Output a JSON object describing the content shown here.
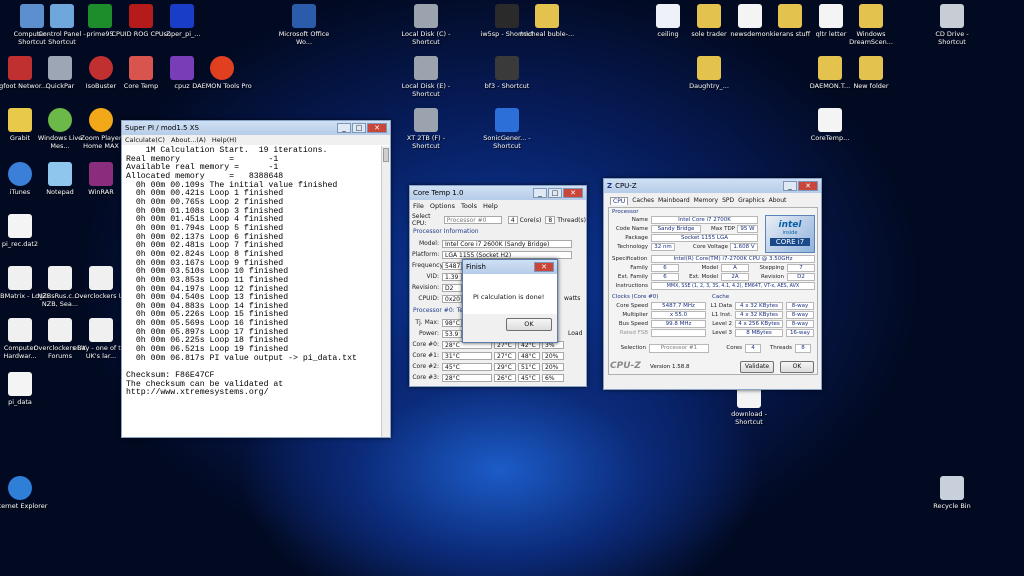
{
  "desktop_icons": {
    "computer": "Computer - Shortcut",
    "control_panel": "Control Panel - Shortcut",
    "prime95": "prime95",
    "cpuid_rog": "CPUID ROG CPU-Z",
    "super_pi": "super_pi_...",
    "ms_office": "Microsoft Office Wo...",
    "local_disk_c": "Local Disk (C) - Shortcut",
    "iw5sp": "iw5sp - Shortcut",
    "micheal_buble": "micheal buble-...",
    "ceiling": "ceiling",
    "sole_trader": "sole trader",
    "newsdemon": "newsdemon",
    "kierans_stuff": "kierans stuff",
    "qltr_letter": "qltr letter",
    "windows_dreamscene": "Windows DreamScen...",
    "cd_drive": "CD Drive - Shortcut",
    "bigfoot": "Bigfoot Networ...",
    "quickpar": "QuickPar",
    "isobuster": "IsoBuster",
    "core_temp": "Core Temp",
    "cpuz": "cpuz",
    "daemon_tools": "DAEMON Tools Pro",
    "local_disk_e": "Local Disk (E) - Shortcut",
    "bf3": "bf3 - Shortcut",
    "daughtry": "Daughtry_...",
    "daemon_t": "DAEMON.T...",
    "new_folder": "New folder",
    "grabit": "Grabit",
    "wlm": "Windows Live Mes...",
    "zoom_player": "Zoom Player Home MAX",
    "xt2tb": "XT 2TB (F) - Shortcut",
    "sonic": "SonicGener... - Shortcut",
    "coretemp_file": "CoreTemp...",
    "itunes": "iTunes",
    "notepad": "Notepad",
    "winrar": "WinRAR",
    "pi_rec": "pi_rec.dat2",
    "nzbmatrix": "NZBMatrix - Login",
    "nzbsrus": "NZBsRus.c... - NZB, Sea...",
    "overclockers1": "Overclockers UK",
    "computer_hw": "Computer Hardwar...",
    "overclockers_forums": "Overclockers UK Forums",
    "ebay": "eBay - one of the UK's lar...",
    "pi_data": "pi_data",
    "ie": "Internet Explorer",
    "download": "download - Shortcut",
    "recycle": "Recycle Bin"
  },
  "superpi": {
    "title": "Super PI / mod1.5 XS",
    "menu": [
      "Calculate(C)",
      "About...(A)",
      "Help(H)"
    ],
    "output": "    1M Calculation Start.  19 iterations.\nReal memory          =       -1\nAvailable real memory =      -1\nAllocated memory     =   8388648\n  0h 00m 00.109s The initial value finished\n  0h 00m 00.421s Loop 1 finished\n  0h 00m 00.765s Loop 2 finished\n  0h 00m 01.108s Loop 3 finished\n  0h 00m 01.451s Loop 4 finished\n  0h 00m 01.794s Loop 5 finished\n  0h 00m 02.137s Loop 6 finished\n  0h 00m 02.481s Loop 7 finished\n  0h 00m 02.824s Loop 8 finished\n  0h 00m 03.167s Loop 9 finished\n  0h 00m 03.510s Loop 10 finished\n  0h 00m 03.853s Loop 11 finished\n  0h 00m 04.197s Loop 12 finished\n  0h 00m 04.540s Loop 13 finished\n  0h 00m 04.883s Loop 14 finished\n  0h 00m 05.226s Loop 15 finished\n  0h 00m 05.569s Loop 16 finished\n  0h 00m 05.897s Loop 17 finished\n  0h 00m 06.225s Loop 18 finished\n  0h 00m 06.521s Loop 19 finished\n  0h 00m 06.817s PI value output -> pi_data.txt\n\nChecksum: F86E47CF\nThe checksum can be validated at\nhttp://www.xtremesystems.org/"
  },
  "coretemp": {
    "title": "Core Temp 1.0",
    "menu": [
      "File",
      "Options",
      "Tools",
      "Help"
    ],
    "select_cpu_label": "Select CPU:",
    "select_cpu_value": "Processor #0",
    "cores": "4",
    "cores_label": "Core(s)",
    "threads": "8",
    "threads_label": "Thread(s)",
    "proc_info": "Processor Information",
    "model_label": "Model:",
    "model": "Intel Core i7 2600K (Sandy Bridge)",
    "platform_label": "Platform:",
    "platform": "LGA 1155 (Socket H2)",
    "frequency_label": "Frequency:",
    "frequency": "5487",
    "vid_label": "VID:",
    "vid": "1.39",
    "revision_label": "Revision:",
    "revision": "D2",
    "cpuid_label": "CPUID:",
    "cpuid": "0x20",
    "watts": "watts",
    "proc0_label": "Processor #0: Ten",
    "tjmax_label": "Tj. Max:",
    "tjmax": "98°C",
    "power_label": "Power:",
    "power": "53.9",
    "load_label": "Load",
    "cores_rows": [
      {
        "name": "Core #0:",
        "temp": "28°C",
        "min": "27°C",
        "max": "42°C",
        "load": "3%"
      },
      {
        "name": "Core #1:",
        "temp": "31°C",
        "min": "27°C",
        "max": "48°C",
        "load": "20%"
      },
      {
        "name": "Core #2:",
        "temp": "45°C",
        "min": "29°C",
        "max": "51°C",
        "load": "20%"
      },
      {
        "name": "Core #3:",
        "temp": "28°C",
        "min": "26°C",
        "max": "45°C",
        "load": "6%"
      }
    ]
  },
  "finish": {
    "title": "Finish",
    "message": "PI calculation is done!",
    "ok": "OK"
  },
  "cpuz": {
    "title": "CPU-Z",
    "tabs": [
      "CPU",
      "Caches",
      "Mainboard",
      "Memory",
      "SPD",
      "Graphics",
      "About"
    ],
    "processor_section": "Processor",
    "name_label": "Name",
    "name": "Intel Core i7 2700K",
    "codename_label": "Code Name",
    "codename": "Sandy Bridge",
    "maxtdp_label": "Max TDP",
    "maxtdp": "95 W",
    "package_label": "Package",
    "package": "Socket 1155 LGA",
    "technology_label": "Technology",
    "technology": "32 nm",
    "corevoltage_label": "Core Voltage",
    "corevoltage": "1.608 V",
    "spec_label": "Specification",
    "spec": "Intel(R) Core(TM) i7-2700K CPU @ 3.50GHz",
    "family_label": "Family",
    "family": "6",
    "model_label": "Model",
    "model": "A",
    "stepping_label": "Stepping",
    "stepping": "7",
    "extfamily_label": "Ext. Family",
    "extfamily": "6",
    "extmodel_label": "Ext. Model",
    "extmodel": "2A",
    "revision_label": "Revision",
    "revision": "D2",
    "instructions_label": "Instructions",
    "instructions": "MMX, SSE (1, 2, 3, 3S, 4.1, 4.2), EM64T, VT-x, AES, AVX",
    "clocks_section": "Clocks (Core #0)",
    "corespeed_label": "Core Speed",
    "corespeed": "5487.7 MHz",
    "multiplier_label": "Multiplier",
    "multiplier": "x 55.0",
    "busspeed_label": "Bus Speed",
    "busspeed": "99.8 MHz",
    "ratedfsb_label": "Rated FSB",
    "cache_section": "Cache",
    "l1d_label": "L1 Data",
    "l1d": "4 x 32 KBytes",
    "l1d_way": "8-way",
    "l1i_label": "L1 Inst.",
    "l1i": "4 x 32 KBytes",
    "l1i_way": "8-way",
    "l2_label": "Level 2",
    "l2": "4 x 256 KBytes",
    "l2_way": "8-way",
    "l3_label": "Level 3",
    "l3": "8 MBytes",
    "l3_way": "16-way",
    "selection_label": "Selection",
    "selection": "Processor #1",
    "cores_label": "Cores",
    "cores": "4",
    "threads_label": "Threads",
    "threads": "8",
    "brand": "CPU-Z",
    "version": "Version 1.58.8",
    "validate": "Validate",
    "ok": "OK",
    "logo_brand": "intel",
    "logo_inside": "inside",
    "logo_core": "CORE i7"
  },
  "colors": {
    "window_title": "#c4d7ee",
    "cpuz_blue": "#1a3080",
    "intel_blue": "#0860a8"
  }
}
